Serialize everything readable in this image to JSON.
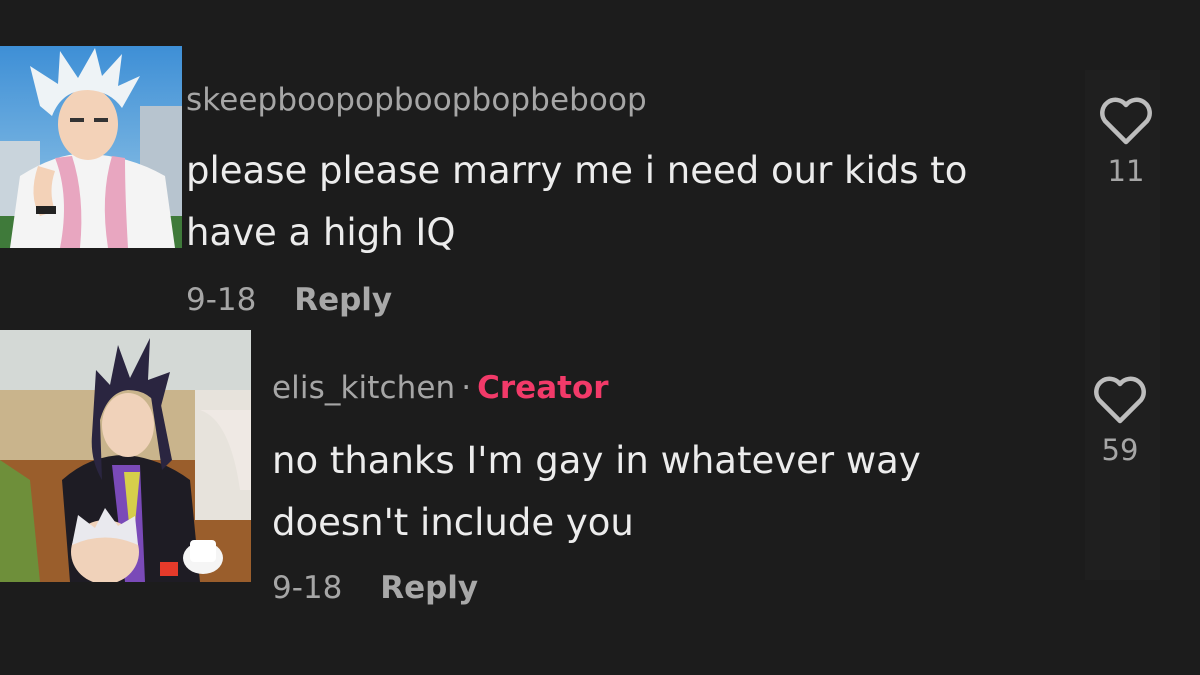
{
  "comments": [
    {
      "username": "skeepboopopboopbopbeboop",
      "text": "please please marry me i need our kids to have a high IQ",
      "date": "9-18",
      "reply_label": "Reply",
      "likes": "11",
      "avatar_icon": "anime-avatar-white-hair"
    },
    {
      "username": "elis_kitchen",
      "separator": "·",
      "badge": "Creator",
      "text": "no thanks I'm gay in whatever way doesn't include you",
      "date": "9-18",
      "reply_label": "Reply",
      "likes": "59",
      "avatar_icon": "anime-avatar-purple-hair"
    }
  ],
  "colors": {
    "background": "#1c1c1c",
    "text_primary": "#ececec",
    "text_secondary": "#a6a6a6",
    "creator_accent": "#f23a69"
  }
}
